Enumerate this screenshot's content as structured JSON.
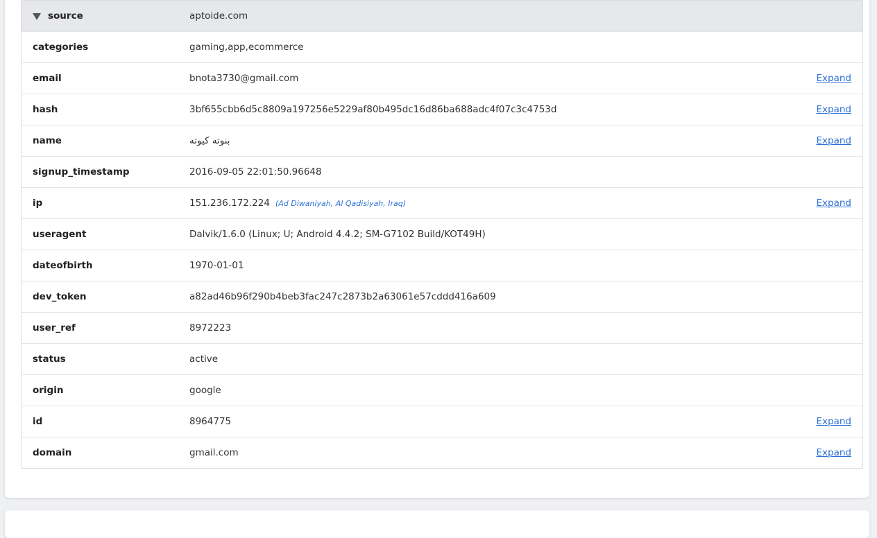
{
  "record": {
    "header": {
      "key": "source",
      "value": "aptoide.com"
    },
    "rows": [
      {
        "key": "categories",
        "value": "gaming,app,ecommerce",
        "expand": ""
      },
      {
        "key": "email",
        "value": "bnota3730@gmail.com",
        "expand": "Expand"
      },
      {
        "key": "hash",
        "value": "3bf655cbb6d5c8809a197256e5229af80b495dc16d86ba688adc4f07c3c4753d",
        "expand": "Expand"
      },
      {
        "key": "name",
        "value": "بنوته كيوته",
        "expand": "Expand"
      },
      {
        "key": "signup_timestamp",
        "value": "2016-09-05 22:01:50.96648",
        "expand": ""
      },
      {
        "key": "ip",
        "value": "151.236.172.224",
        "geo": "(Ad Diwaniyah, Al Qadisiyah, Iraq)",
        "expand": "Expand"
      },
      {
        "key": "useragent",
        "value": "Dalvik/1.6.0 (Linux; U; Android 4.4.2; SM-G7102 Build/KOT49H)",
        "expand": ""
      },
      {
        "key": "dateofbirth",
        "value": "1970-01-01",
        "expand": ""
      },
      {
        "key": "dev_token",
        "value": "a82ad46b96f290b4beb3fac247c2873b2a63061e57cddd416a609",
        "expand": ""
      },
      {
        "key": "user_ref",
        "value": "8972223",
        "expand": ""
      },
      {
        "key": "status",
        "value": "active",
        "expand": ""
      },
      {
        "key": "origin",
        "value": "google",
        "expand": ""
      },
      {
        "key": "id",
        "value": "8964775",
        "expand": "Expand"
      },
      {
        "key": "domain",
        "value": "gmail.com",
        "expand": "Expand"
      }
    ]
  },
  "colors": {
    "link": "#2b6fd6",
    "header_bg": "#e7e8eb",
    "page_bg": "#eef0f3"
  }
}
